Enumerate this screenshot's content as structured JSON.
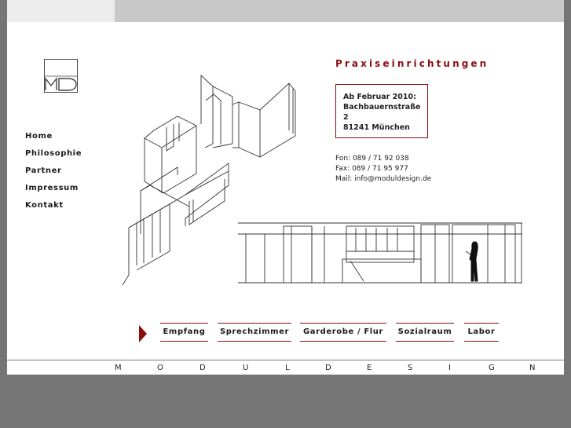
{
  "nav": {
    "items": [
      "Home",
      "Philosophie",
      "Partner",
      "Impressum",
      "Kontakt"
    ]
  },
  "main": {
    "heading": "Praxiseinrichtungen",
    "address": {
      "line1": "Ab Februar 2010:",
      "line2": "Bachbauernstraße",
      "line3": "2",
      "line4": "81241 München"
    },
    "contact": {
      "phone": "Fon: 089 / 71 92 038",
      "fax": "Fax: 089 / 71 95 977",
      "mail": "Mail: info@moduldesign.de"
    }
  },
  "tabs": [
    "Empfang",
    "Sprechzimmer",
    "Garderobe / Flur",
    "Sozialraum",
    "Labor"
  ],
  "footer": {
    "letters": [
      "M",
      "O",
      "D",
      "U",
      "L",
      "D",
      "E",
      "S",
      "I",
      "G",
      "N"
    ]
  },
  "colors": {
    "accent": "#8b0e10",
    "background": "#757575",
    "topbar": "#c8c8c8"
  },
  "icons": {
    "logo": "md-logo-icon",
    "tab_indicator": "triangle-right-icon"
  }
}
